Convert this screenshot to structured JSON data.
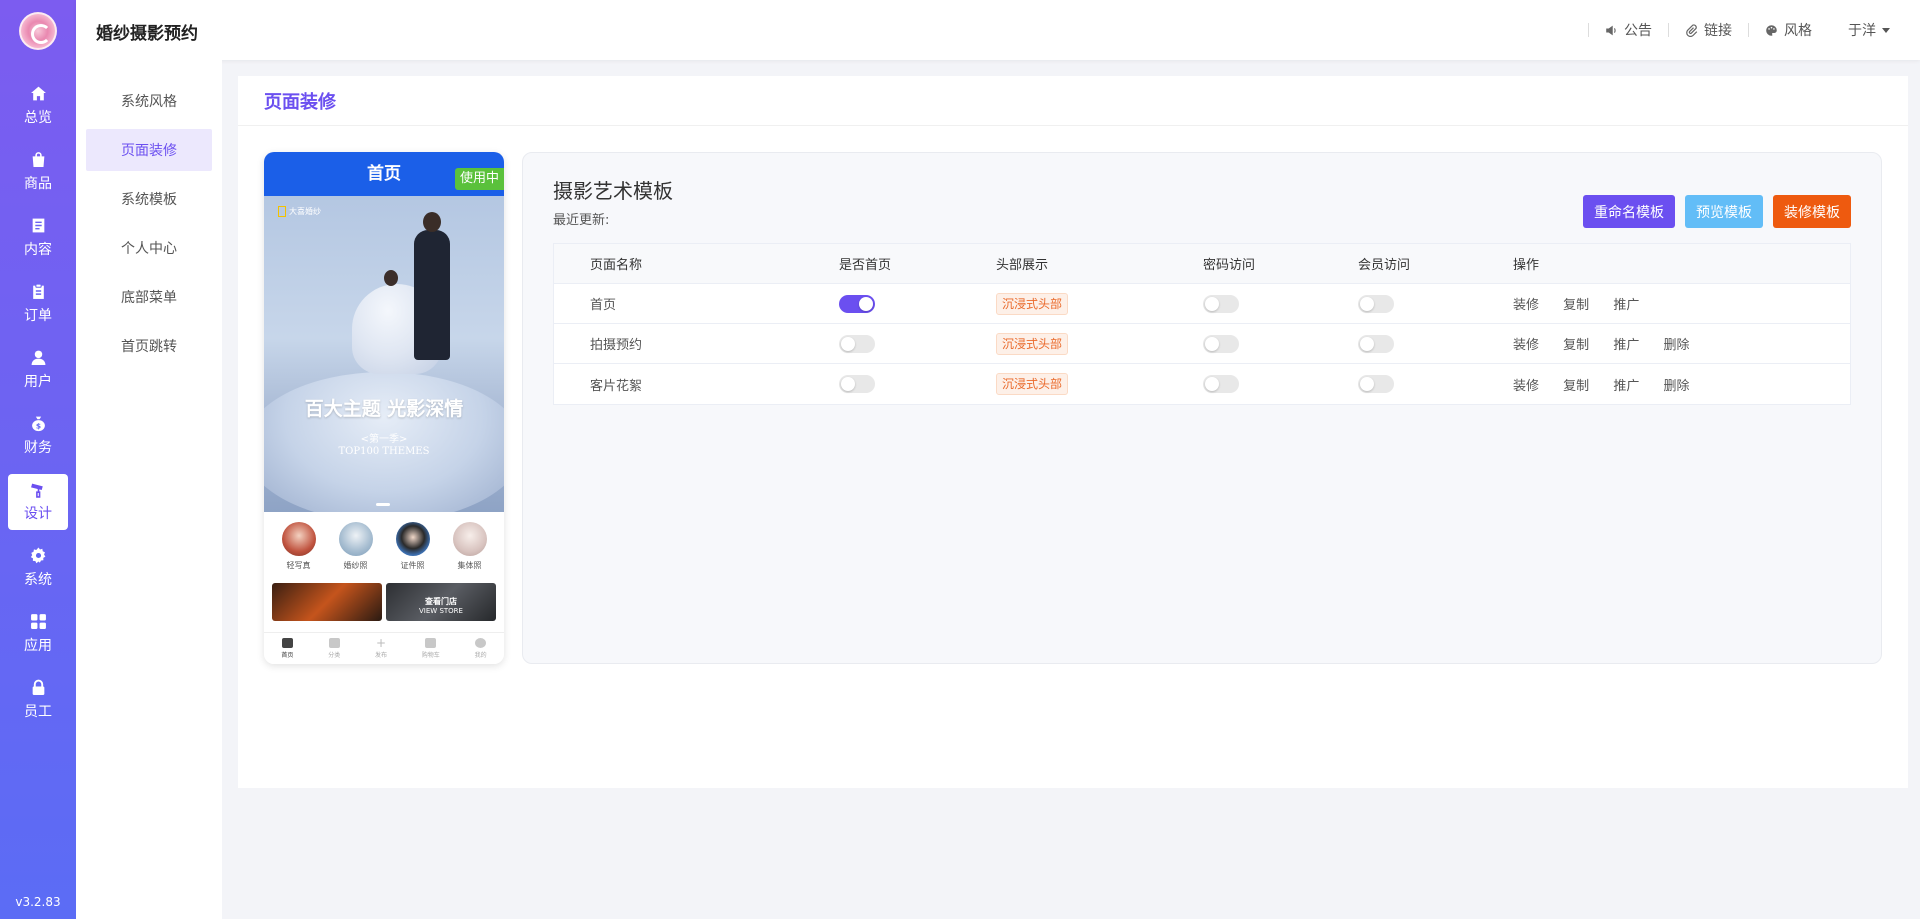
{
  "sidebar": {
    "version": "v3.2.83",
    "items": [
      {
        "label": "总览",
        "icon": "home-icon"
      },
      {
        "label": "商品",
        "icon": "bag-icon"
      },
      {
        "label": "内容",
        "icon": "document-icon"
      },
      {
        "label": "订单",
        "icon": "clipboard-icon"
      },
      {
        "label": "用户",
        "icon": "user-icon"
      },
      {
        "label": "财务",
        "icon": "money-bag-icon"
      },
      {
        "label": "设计",
        "icon": "paint-roller-icon"
      },
      {
        "label": "系统",
        "icon": "gear-icon"
      },
      {
        "label": "应用",
        "icon": "grid-icon"
      },
      {
        "label": "员工",
        "icon": "lock-icon"
      }
    ],
    "active_index": 6
  },
  "header": {
    "app_title": "婚纱摄影预约",
    "links": [
      {
        "label": "公告",
        "icon": "speaker-icon"
      },
      {
        "label": "链接",
        "icon": "paperclip-icon"
      },
      {
        "label": "风格",
        "icon": "palette-icon"
      }
    ],
    "user_name": "于洋"
  },
  "subnav": {
    "items": [
      "系统风格",
      "页面装修",
      "系统模板",
      "个人中心",
      "底部菜单",
      "首页跳转"
    ],
    "active_index": 1
  },
  "page": {
    "title": "页面装修"
  },
  "phone_preview": {
    "title": "首页",
    "status_badge": "使用中",
    "banner": {
      "logo_text": "大喜婚纱",
      "headline": "百大主题 光影深情",
      "season": "<第一季>",
      "english": "TOP100 THEMES"
    },
    "categories": [
      {
        "label": "轻写真",
        "color": "#c0533f"
      },
      {
        "label": "婚纱照",
        "color": "#7a9bb8"
      },
      {
        "label": "证件照",
        "color": "#3c6fb0"
      },
      {
        "label": "集体照",
        "color": "#d8c3bf"
      }
    ],
    "store_tile": {
      "title": "查看门店",
      "subtitle": "VIEW STORE"
    },
    "tabbar": [
      "首页",
      "分类",
      "发布",
      "购物车",
      "我的"
    ]
  },
  "template": {
    "name": "摄影艺术模板",
    "updated_label": "最近更新:",
    "buttons": [
      {
        "label": "重命名模板",
        "color": "#6b4ff0"
      },
      {
        "label": "预览模板",
        "color": "#62bdf7"
      },
      {
        "label": "装修模板",
        "color": "#ee5a0f"
      }
    ]
  },
  "table": {
    "headers": [
      "页面名称",
      "是否首页",
      "头部展示",
      "密码访问",
      "会员访问",
      "操作"
    ],
    "rows": [
      {
        "name": "首页",
        "is_home": true,
        "header_tag": "沉浸式头部",
        "password": false,
        "member": false,
        "ops": [
          "装修",
          "复制",
          "推广"
        ]
      },
      {
        "name": "拍摄预约",
        "is_home": false,
        "header_tag": "沉浸式头部",
        "password": false,
        "member": false,
        "ops": [
          "装修",
          "复制",
          "推广",
          "删除"
        ]
      },
      {
        "name": "客片花絮",
        "is_home": false,
        "header_tag": "沉浸式头部",
        "password": false,
        "member": false,
        "ops": [
          "装修",
          "复制",
          "推广",
          "删除"
        ]
      }
    ]
  }
}
